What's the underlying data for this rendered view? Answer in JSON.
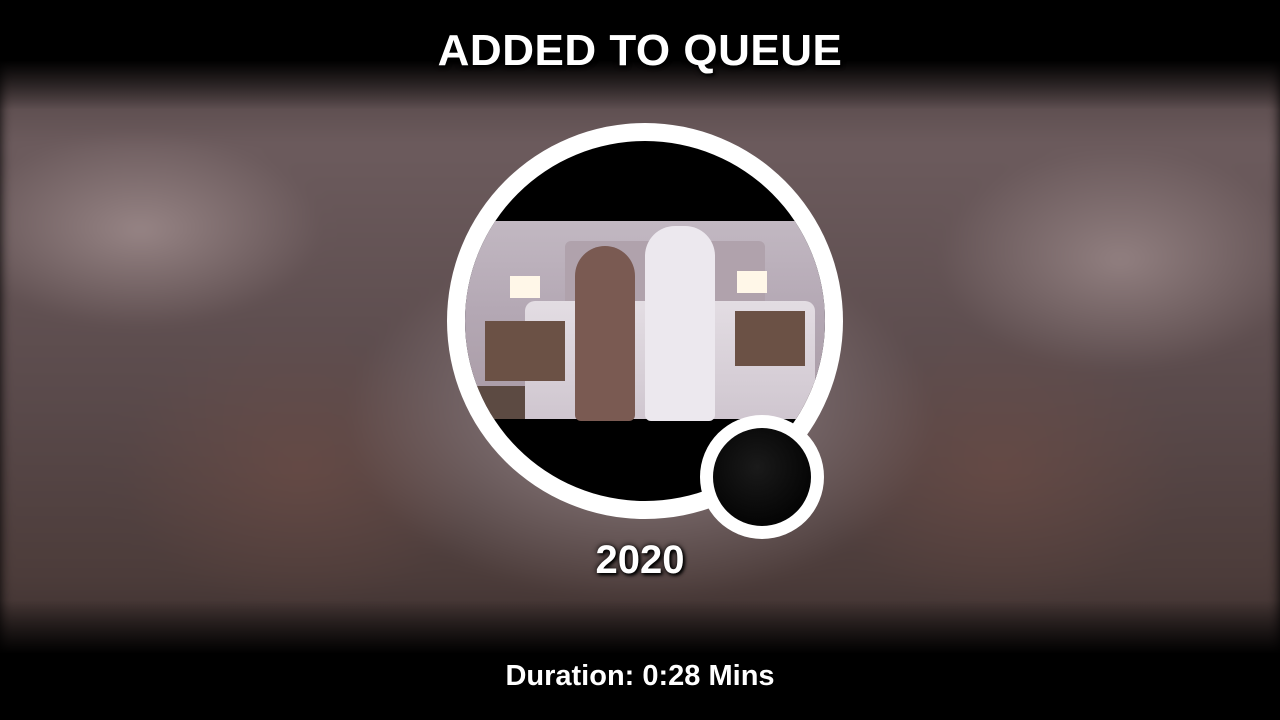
{
  "header": {
    "title": "ADDED TO QUEUE"
  },
  "track": {
    "title": "2020",
    "duration_label": "Duration: 0:28 Mins"
  },
  "colors": {
    "text": "#ffffff",
    "ring": "#ffffff",
    "background": "#000000"
  }
}
